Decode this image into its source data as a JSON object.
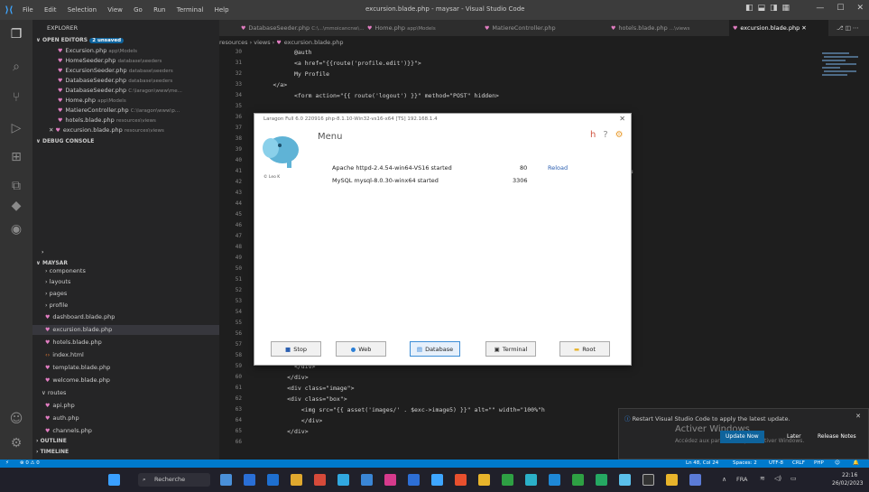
{
  "titlebar": {
    "menu": [
      "File",
      "Edit",
      "Selection",
      "View",
      "Go",
      "Run",
      "Terminal",
      "Help"
    ],
    "title": "excursion.blade.php - maysar - Visual Studio Code"
  },
  "explorer": {
    "header": "EXPLORER",
    "open_editors_label": "OPEN EDITORS",
    "unsaved_badge": "2 unsaved",
    "open_editors": [
      {
        "name": "Excursion.php",
        "path": "app\\Models"
      },
      {
        "name": "HomeSeeder.php",
        "path": "database\\seeders"
      },
      {
        "name": "ExcursionSeeder.php",
        "path": "database\\seeders"
      },
      {
        "name": "DatabaseSeeder.php",
        "path": "database\\seeders"
      },
      {
        "name": "DatabaseSeeder.php",
        "path": "C:\\laragon\\www\\me..."
      },
      {
        "name": "Home.php",
        "path": "app\\Models"
      },
      {
        "name": "MatiereController.php",
        "path": "C:\\laragon\\www\\p..."
      },
      {
        "name": "hotels.blade.php",
        "path": "resources\\views"
      },
      {
        "name": "excursion.blade.php",
        "path": "resources\\views"
      }
    ],
    "debug_console": "DEBUG CONSOLE",
    "project": "MAYSAR",
    "tree": [
      "components",
      "layouts",
      "pages",
      "profile",
      "dashboard.blade.php",
      "excursion.blade.php",
      "hotels.blade.php",
      "index.html",
      "template.blade.php",
      "welcome.blade.php",
      "routes",
      "api.php",
      "auth.php",
      "channels.php"
    ],
    "outline": "OUTLINE",
    "timeline": "TIMELINE"
  },
  "tabs": [
    {
      "label": "DatabaseSeeder.php",
      "path": "C:\\...\\mmoicancnw\\..."
    },
    {
      "label": "Home.php",
      "path": "app\\Models"
    },
    {
      "label": "MatiereController.php",
      "path": ""
    },
    {
      "label": "hotels.blade.php",
      "path": "...\\views"
    },
    {
      "label": "excursion.blade.php",
      "path": ""
    }
  ],
  "breadcrumb": [
    "resources",
    "views",
    "excursion.blade.php"
  ],
  "code": [
    {
      "n": "30",
      "t": "            @auth"
    },
    {
      "n": "31",
      "t": "            <a href=\"{{route('profile.edit')}}\">"
    },
    {
      "n": "32",
      "t": "            My Profile"
    },
    {
      "n": "33",
      "t": "      </a>"
    },
    {
      "n": "34",
      "t": "            <form action=\"{{ route('logout') }}\" method=\"POST\" hidden>"
    },
    {
      "n": "35",
      "t": ""
    },
    {
      "n": "36",
      "t": ""
    },
    {
      "n": "37",
      "t": "                                                                   tsibling.submit();\">"
    },
    {
      "n": "38",
      "t": "                                                                   \" height=\"20px\"></a>"
    },
    {
      "n": "39",
      "t": ""
    },
    {
      "n": "40",
      "t": ""
    },
    {
      "n": "41",
      "t": "                                                                   mx-0 bg-white text-gray-800 font-bold rou"
    },
    {
      "n": "42",
      "t": ""
    },
    {
      "n": "43",
      "t": ""
    },
    {
      "n": "44",
      "t": ""
    },
    {
      "n": "45",
      "t": ""
    },
    {
      "n": "46",
      "t": ""
    },
    {
      "n": "47",
      "t": ""
    },
    {
      "n": "48",
      "t": ""
    },
    {
      "n": "49",
      "t": ""
    },
    {
      "n": "50",
      "t": ""
    },
    {
      "n": "51",
      "t": ""
    },
    {
      "n": "52",
      "t": ""
    },
    {
      "n": "53",
      "t": "                                                                   ght=\"100%\" >"
    },
    {
      "n": "54",
      "t": ""
    },
    {
      "n": "55",
      "t": ""
    },
    {
      "n": "56",
      "t": ""
    },
    {
      "n": "57",
      "t": ""
    },
    {
      "n": "58",
      "t": "                                                                   ght=\"100%\">"
    },
    {
      "n": "59",
      "t": "            </div>"
    },
    {
      "n": "60",
      "t": "          </div>"
    },
    {
      "n": "61",
      "t": "          <div class=\"image\">"
    },
    {
      "n": "62",
      "t": "          <div class=\"box\">"
    },
    {
      "n": "63",
      "t": "              <img src=\"{{ asset('images/' . $exc->image5) }}\" alt=\"\" width=\"100%\"h"
    },
    {
      "n": "64",
      "t": "              </div>"
    },
    {
      "n": "65",
      "t": "          </div>"
    },
    {
      "n": "66",
      "t": ""
    }
  ],
  "laragon": {
    "title": "Laragon Full 6.0 220916 php-8.1.10-Win32-vs16-x64 [TS] 192.168.1.4",
    "menu_label": "Menu",
    "version_label": "© Leo K",
    "services": [
      {
        "name": "Apache httpd-2.4.54-win64-VS16 started",
        "port": "80",
        "action": "Reload"
      },
      {
        "name": "MySQL mysql-8.0.30-winx64 started",
        "port": "3306",
        "action": ""
      }
    ],
    "buttons": [
      "Stop",
      "Web",
      "Database",
      "Terminal",
      "Root"
    ]
  },
  "notification": {
    "message": "Restart Visual Studio Code to apply the latest update.",
    "buttons": [
      "Update Now",
      "Later",
      "Release Notes"
    ],
    "watermark_title": "Activer Windows",
    "watermark_sub": "Accédez aux paramètres pour activer Windows."
  },
  "status": {
    "left": "⊗ 0 ⚠ 0",
    "right": [
      "Ln 48, Col 24",
      "Spaces: 2",
      "UTF-8",
      "CRLF",
      "PHP"
    ]
  },
  "taskbar": {
    "search_placeholder": "Recherche",
    "lang": "FRA",
    "time": "22:16",
    "date": "26/02/2023"
  }
}
